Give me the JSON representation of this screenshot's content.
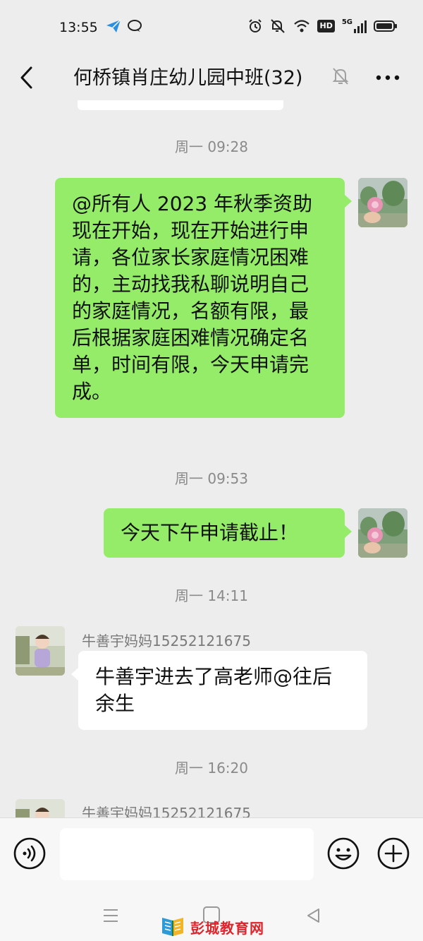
{
  "status_bar": {
    "time": "13:55",
    "left_icons": [
      "paper-plane-icon",
      "chat-bubble-icon"
    ],
    "right_icons": [
      "alarm-icon",
      "mute-bell-icon",
      "wifi-icon",
      "hd-badge",
      "signal-5g-icon",
      "battery-icon"
    ],
    "hd_label": "HD",
    "network_label": "5G"
  },
  "header": {
    "back_icon": "chevron-left-icon",
    "title": "何桥镇肖庄幼儿园中班(32)",
    "mute_icon": "bell-off-icon",
    "more_icon": "more-dots-icon"
  },
  "messages": [
    {
      "type": "time",
      "text": "周一 09:28"
    },
    {
      "type": "sent",
      "text": "@所有人  2023 年秋季资助现在开始，现在开始进行申请，各位家长家庭情况困难的，主动找我私聊说明自己的家庭情况，名额有限，最后根据家庭困难情况确定名单，时间有限，今天申请完成。"
    },
    {
      "type": "time",
      "text": "周一 09:53"
    },
    {
      "type": "sent",
      "text": "今天下午申请截止！"
    },
    {
      "type": "time",
      "text": "周一 14:11"
    },
    {
      "type": "received",
      "sender": "牛善宇妈妈15252121675",
      "text": "牛善宇进去了高老师@往后余生"
    },
    {
      "type": "time",
      "text": "周一 16:20"
    },
    {
      "type": "received",
      "sender": "牛善宇妈妈15252121675",
      "text": ""
    }
  ],
  "input_bar": {
    "voice_icon": "voice-icon",
    "input_value": "",
    "emoji_icon": "emoji-icon",
    "plus_icon": "plus-circle-icon"
  },
  "nav_bar": {
    "icons": [
      "menu-icon",
      "home-square-icon",
      "back-triangle-icon"
    ]
  },
  "watermark": {
    "text": "彭城教育网"
  },
  "colors": {
    "background": "#ededed",
    "sent_bubble": "#95ec69",
    "received_bubble": "#ffffff",
    "timestamp": "#8a8a8a",
    "watermark": "#e0242b"
  }
}
